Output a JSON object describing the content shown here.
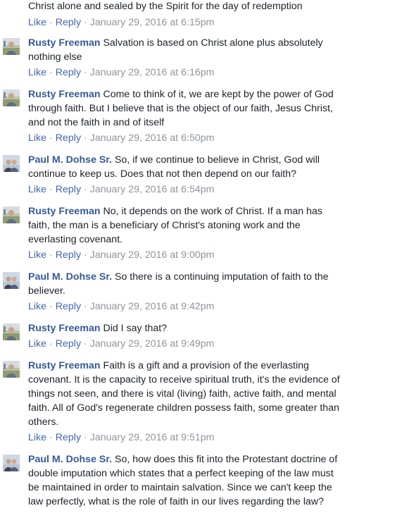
{
  "top": {
    "text": "Christ alone and sealed by the Spirit for the day of redemption",
    "like": "Like",
    "reply": "Reply",
    "time": "January 29, 2016 at 6:15pm"
  },
  "colors": {
    "link": "#4267b2",
    "author": "#365899",
    "meta": "#90949c",
    "text": "#1d2129"
  },
  "comments": [
    {
      "author": "Rusty Freeman",
      "lines": [
        "Salvation is based on Christ alone plus absolutely",
        "nothing else"
      ],
      "like": "Like",
      "reply": "Reply",
      "time": "January 29, 2016 at 6:16pm",
      "avatar": "rusty-avatar"
    },
    {
      "author": "Rusty Freeman",
      "lines": [
        "Come to think of it, we are kept by the power of God",
        "through faith. But I believe that is the object of our faith, Jesus Christ,",
        "and not the faith in and of itself"
      ],
      "like": "Like",
      "reply": "Reply",
      "time": "January 29, 2016 at 6:50pm",
      "avatar": "rusty-avatar"
    },
    {
      "author": "Paul M. Dohse Sr.",
      "lines": [
        "So, if we continue to believe in Christ, God will",
        "continue to keep us. Does that not then depend on our faith?"
      ],
      "like": "Like",
      "reply": "Reply",
      "time": "January 29, 2016 at 6:54pm",
      "avatar": "paul-avatar"
    },
    {
      "author": "Rusty Freeman",
      "lines": [
        "No, it depends on the work of Christ. If a man has",
        "faith, the man is a beneficiary of Christ's atoning work and the",
        "everlasting covenant."
      ],
      "like": "Like",
      "reply": "Reply",
      "time": "January 29, 2016 at 9:00pm",
      "avatar": "rusty-avatar"
    },
    {
      "author": "Paul M. Dohse Sr.",
      "lines": [
        "So there is a continuing imputation of faith to the",
        "believer."
      ],
      "like": "Like",
      "reply": "Reply",
      "time": "January 29, 2016 at 9:42pm",
      "avatar": "paul-avatar"
    },
    {
      "author": "Rusty Freeman",
      "lines": [
        "Did I say that?"
      ],
      "like": "Like",
      "reply": "Reply",
      "time": "January 29, 2016 at 9:49pm",
      "avatar": "rusty-avatar"
    },
    {
      "author": "Rusty Freeman",
      "lines": [
        "Faith is a gift and a provision of the everlasting",
        "covenant. It is the capacity to receive spiritual truth, it's the evidence of",
        "things not seen, and there is vital (living) faith, active faith, and mental",
        "faith. All of God's regenerate children possess faith, some greater than",
        "others."
      ],
      "like": "Like",
      "reply": "Reply",
      "time": "January 29, 2016 at 9:51pm",
      "avatar": "rusty-avatar"
    },
    {
      "author": "Paul M. Dohse Sr.",
      "lines": [
        "So, how does this fit into the Protestant doctrine of",
        "double imputation which states that a perfect keeping of the law must",
        "be maintained in order to maintain salvation. Since we can't keep the",
        "law perfectly, what is the role of faith in our lives regarding the law?"
      ],
      "like": "",
      "reply": "",
      "time": "",
      "avatar": "paul-avatar"
    }
  ]
}
